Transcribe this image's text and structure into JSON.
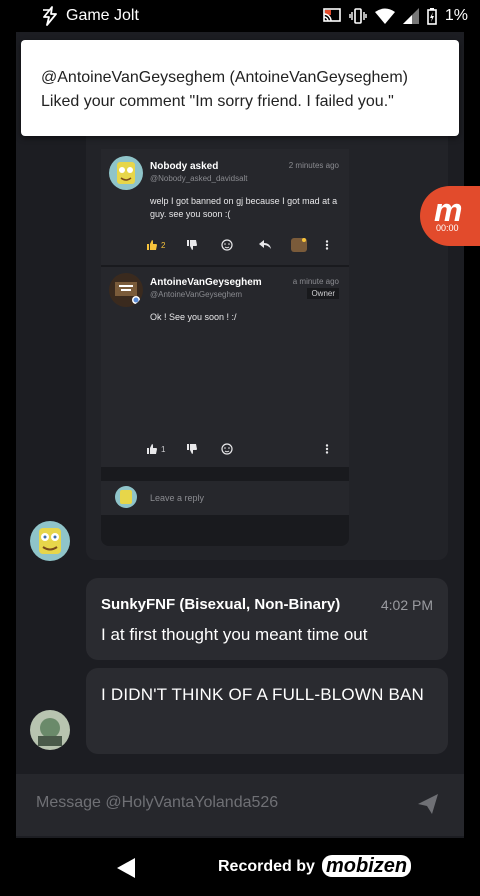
{
  "status_bar": {
    "app_name": "Game Jolt",
    "battery": "1%",
    "icons": [
      "gamejolt-bolt-icon",
      "cast-icon",
      "vibrate-icon",
      "wifi-icon",
      "signal-icon",
      "battery-icon"
    ]
  },
  "notification": {
    "title": "@AntoineVanGeyseghem (AntoineVanGeyseghem)",
    "text": "Liked your comment \"Im sorry friend. I failed you.\""
  },
  "thread": {
    "comments": [
      {
        "author": "Nobody asked",
        "handle": "@Nobody_asked_davidsalt",
        "time": "2 minutes ago",
        "text": "welp I got banned on gj because I got mad at a guy. see you soon :(",
        "likes": "2"
      },
      {
        "author": "AntoineVanGeyseghem",
        "handle": "@AntoineVanGeyseghem",
        "time": "a minute ago",
        "tag": "Owner",
        "text": "Ok ! See you soon ! :/",
        "likes": "1"
      }
    ],
    "reply_placeholder": "Leave a reply"
  },
  "recording": {
    "logo": "m",
    "timer": "00:00"
  },
  "messages": [
    {
      "name": "SunkyFNF (Bisexual, Non-Binary)",
      "time": "4:02 PM",
      "text": "I at first thought you meant time out"
    },
    {
      "text": "I DIDN'T THINK OF A FULL-BLOWN BAN"
    }
  ],
  "composer": {
    "placeholder": "Message @HolyVantaYolanda526"
  },
  "nav": {
    "recorded_by": "Recorded by",
    "brand": "mobizen"
  },
  "colors": {
    "app_bg": "#1c1d22",
    "bubble_bg": "#2a2b30",
    "like_accent": "#f7c33b",
    "recorder": "#e24b2c"
  }
}
